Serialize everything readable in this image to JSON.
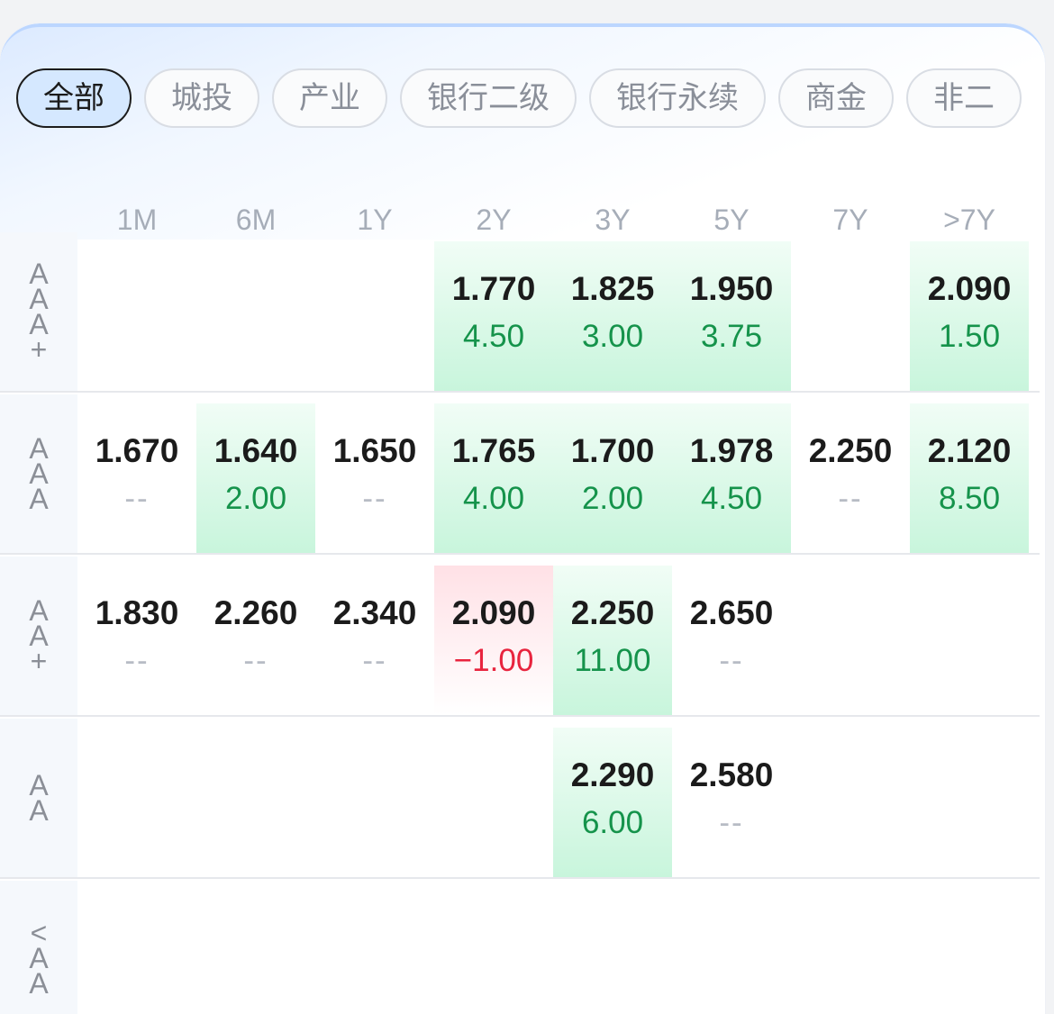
{
  "tabs": [
    {
      "label": "全部",
      "active": true
    },
    {
      "label": "城投",
      "active": false
    },
    {
      "label": "产业",
      "active": false
    },
    {
      "label": "银行二级",
      "active": false
    },
    {
      "label": "银行永续",
      "active": false
    },
    {
      "label": "商金",
      "active": false
    },
    {
      "label": "非二",
      "active": false
    }
  ],
  "columns": [
    "1M",
    "6M",
    "1Y",
    "2Y",
    "3Y",
    "5Y",
    "7Y",
    ">7Y"
  ],
  "rows": [
    {
      "label": "AAA+",
      "cells": [
        null,
        null,
        null,
        {
          "yield": "1.770",
          "change": "4.50",
          "trend": "up"
        },
        {
          "yield": "1.825",
          "change": "3.00",
          "trend": "up"
        },
        {
          "yield": "1.950",
          "change": "3.75",
          "trend": "up"
        },
        null,
        {
          "yield": "2.090",
          "change": "1.50",
          "trend": "up"
        }
      ]
    },
    {
      "label": "AAA",
      "cells": [
        {
          "yield": "1.670",
          "change": "--",
          "trend": "none"
        },
        {
          "yield": "1.640",
          "change": "2.00",
          "trend": "up"
        },
        {
          "yield": "1.650",
          "change": "--",
          "trend": "none"
        },
        {
          "yield": "1.765",
          "change": "4.00",
          "trend": "up"
        },
        {
          "yield": "1.700",
          "change": "2.00",
          "trend": "up"
        },
        {
          "yield": "1.978",
          "change": "4.50",
          "trend": "up"
        },
        {
          "yield": "2.250",
          "change": "--",
          "trend": "none"
        },
        {
          "yield": "2.120",
          "change": "8.50",
          "trend": "up"
        }
      ]
    },
    {
      "label": "AA+",
      "cells": [
        {
          "yield": "1.830",
          "change": "--",
          "trend": "none"
        },
        {
          "yield": "2.260",
          "change": "--",
          "trend": "none"
        },
        {
          "yield": "2.340",
          "change": "--",
          "trend": "none"
        },
        {
          "yield": "2.090",
          "change": "−1.00",
          "trend": "down"
        },
        {
          "yield": "2.250",
          "change": "11.00",
          "trend": "up"
        },
        {
          "yield": "2.650",
          "change": "--",
          "trend": "none"
        },
        null,
        null
      ]
    },
    {
      "label": "AA",
      "cells": [
        null,
        null,
        null,
        null,
        {
          "yield": "2.290",
          "change": "6.00",
          "trend": "up"
        },
        {
          "yield": "2.580",
          "change": "--",
          "trend": "none"
        },
        null,
        null
      ]
    },
    {
      "label": "<AA",
      "cells": [
        null,
        null,
        null,
        null,
        null,
        null,
        null,
        null
      ]
    }
  ]
}
